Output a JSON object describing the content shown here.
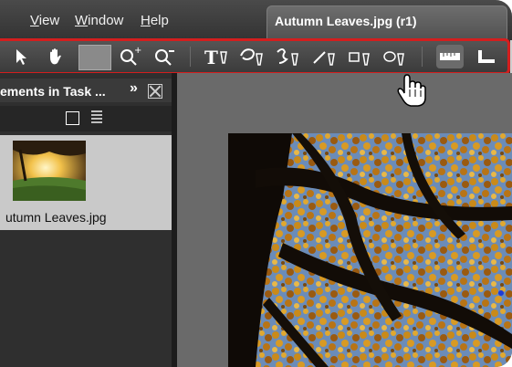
{
  "menubar": {
    "items": [
      {
        "label": "View",
        "underline": "V",
        "rest": "iew"
      },
      {
        "label": "Window",
        "underline": "W",
        "rest": "indow"
      },
      {
        "label": "Help",
        "underline": "H",
        "rest": "elp"
      }
    ],
    "document_tab": "Autumn Leaves.jpg (r1)"
  },
  "toolbar": {
    "tools": [
      "select-tool",
      "hand-tool",
      "selected-tool",
      "zoom-in-tool",
      "zoom-out-tool",
      "text-tool",
      "lasso-tool",
      "freehand-tool",
      "line-tool",
      "rectangle-tool",
      "ellipse-tool",
      "ruler-tool",
      "measure-tool"
    ]
  },
  "panel": {
    "title": "ements in Task ...",
    "chevron": "»",
    "item_label": "utumn Leaves.jpg"
  },
  "colors": {
    "highlight_border": "#d41e1e",
    "menubar": "#3a3a3a",
    "canvas": "#6a6a6a",
    "selected_item": "#c9c9c9"
  }
}
